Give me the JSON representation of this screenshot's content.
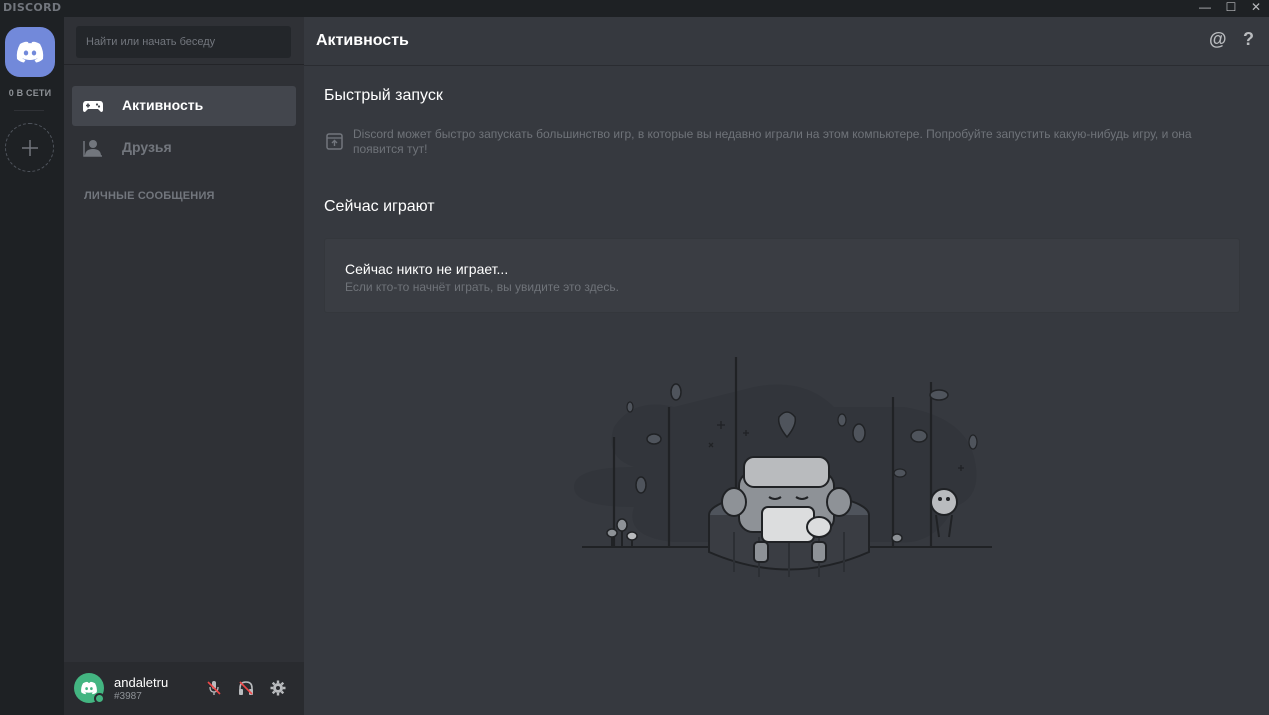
{
  "window": {
    "brand": "DISCORD",
    "minimize_label": "—",
    "maximize_label": "☐",
    "close_label": "✕"
  },
  "guilds": {
    "online_count_label": "0 В СЕТИ"
  },
  "channels": {
    "search_placeholder": "Найти или начать беседу",
    "nav": [
      {
        "label": "Активность",
        "icon": "gamepad-icon",
        "active": true
      },
      {
        "label": "Друзья",
        "icon": "friends-icon",
        "active": false
      }
    ],
    "dm_header": "ЛИЧНЫЕ СООБЩЕНИЯ"
  },
  "user": {
    "name": "andaletru",
    "discriminator": "#3987",
    "status_color": "#43b581"
  },
  "main": {
    "title": "Активность",
    "quick_launch": {
      "title": "Быстрый запуск",
      "text": "Discord может быстро запускать большинство игр, в которые вы недавно играли на этом компьютере. Попробуйте запустить какую-нибудь игру, и она появится тут!"
    },
    "now_playing": {
      "title": "Сейчас играют",
      "card_title": "Сейчас никто не играет...",
      "card_subtitle": "Если кто-то начнёт играть, вы увидите это здесь."
    },
    "header_icons": [
      "mention-icon",
      "help-icon"
    ]
  },
  "colors": {
    "accent": "#7289da",
    "online": "#43b581"
  }
}
